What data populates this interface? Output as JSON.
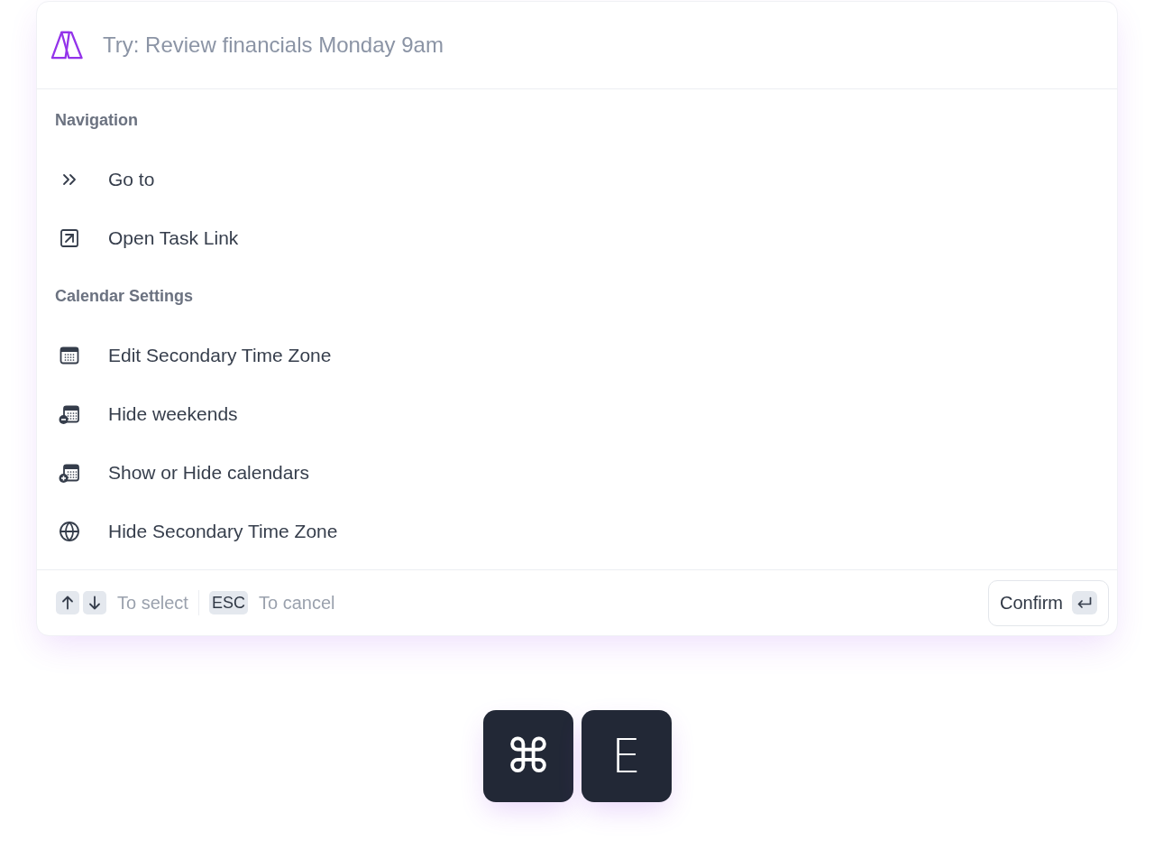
{
  "search": {
    "placeholder": "Try: Review financials Monday 9am"
  },
  "sections": [
    {
      "title": "Navigation",
      "items": [
        {
          "label": "Go to"
        },
        {
          "label": "Open Task Link"
        }
      ]
    },
    {
      "title": "Calendar Settings",
      "items": [
        {
          "label": "Edit Secondary Time Zone"
        },
        {
          "label": "Hide weekends"
        },
        {
          "label": "Show or Hide calendars"
        },
        {
          "label": "Hide Secondary Time Zone"
        }
      ]
    }
  ],
  "footer": {
    "hints": [
      {
        "kind": "arrows",
        "label": "To select"
      },
      {
        "kind": "key",
        "key": "ESC",
        "label": "To cancel"
      }
    ],
    "confirm": {
      "label": "Confirm"
    }
  },
  "shortcut": {
    "keys": [
      "⌘",
      "E"
    ]
  }
}
